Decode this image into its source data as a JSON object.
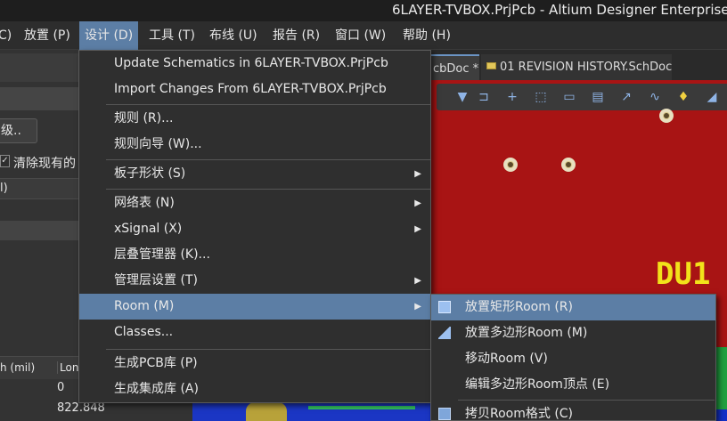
{
  "titlebar": {
    "title": "6LAYER-TVBOX.PrjPcb - Altium Designer Enterprise ("
  },
  "menubar": {
    "items": [
      {
        "label": "C)"
      },
      {
        "label": "放置 (P)"
      },
      {
        "label": "设计 (D)"
      },
      {
        "label": "工具 (T)"
      },
      {
        "label": "布线 (U)"
      },
      {
        "label": "报告 (R)"
      },
      {
        "label": "窗口 (W)"
      },
      {
        "label": "帮助 (H)"
      }
    ]
  },
  "left_panel": {
    "button_label": "级..",
    "checkbox_label": "清除现有的",
    "row_label": "l)",
    "table": {
      "headers": [
        "h (mil)",
        "Lon"
      ],
      "values": [
        "0",
        "822.848"
      ]
    }
  },
  "tabs": [
    {
      "label": "cbDoc *"
    },
    {
      "label": "01 REVISION HISTORY.SchDoc"
    }
  ],
  "canvas": {
    "designator": "DU1",
    "toolbar_icons": [
      "filter-icon",
      "route-icon",
      "add-icon",
      "select-rect-icon",
      "align-icon",
      "component-icon",
      "interactive-route-icon",
      "diff-pair-icon",
      "place-string-icon",
      "dimension-icon"
    ]
  },
  "design_menu": {
    "items": [
      {
        "label": "Update Schematics in 6LAYER-TVBOX.PrjPcb",
        "submenu": false
      },
      {
        "label": "Import Changes From 6LAYER-TVBOX.PrjPcb",
        "submenu": false
      },
      {
        "label": "规则 (R)...",
        "submenu": false
      },
      {
        "label": "规则向导 (W)...",
        "submenu": false
      },
      {
        "label": "板子形状 (S)",
        "submenu": true
      },
      {
        "label": "网络表 (N)",
        "submenu": true
      },
      {
        "label": "xSignal (X)",
        "submenu": true
      },
      {
        "label": "层叠管理器 (K)...",
        "submenu": false
      },
      {
        "label": "管理层设置 (T)",
        "submenu": true
      },
      {
        "label": "Room (M)",
        "submenu": true
      },
      {
        "label": "Classes...",
        "submenu": false
      },
      {
        "label": "生成PCB库 (P)",
        "submenu": false
      },
      {
        "label": "生成集成库 (A)",
        "submenu": false
      }
    ],
    "arrow_glyph": "▶"
  },
  "room_submenu": {
    "items": [
      {
        "label": "放置矩形Room (R)",
        "icon": "rect-room-icon"
      },
      {
        "label": "放置多边形Room (M)",
        "icon": "polygon-room-icon"
      },
      {
        "label": "移动Room (V)",
        "icon": ""
      },
      {
        "label": "编辑多边形Room顶点 (E)",
        "icon": ""
      },
      {
        "label": "拷贝Room格式 (C)",
        "icon": "copy-room-format-icon"
      }
    ]
  }
}
